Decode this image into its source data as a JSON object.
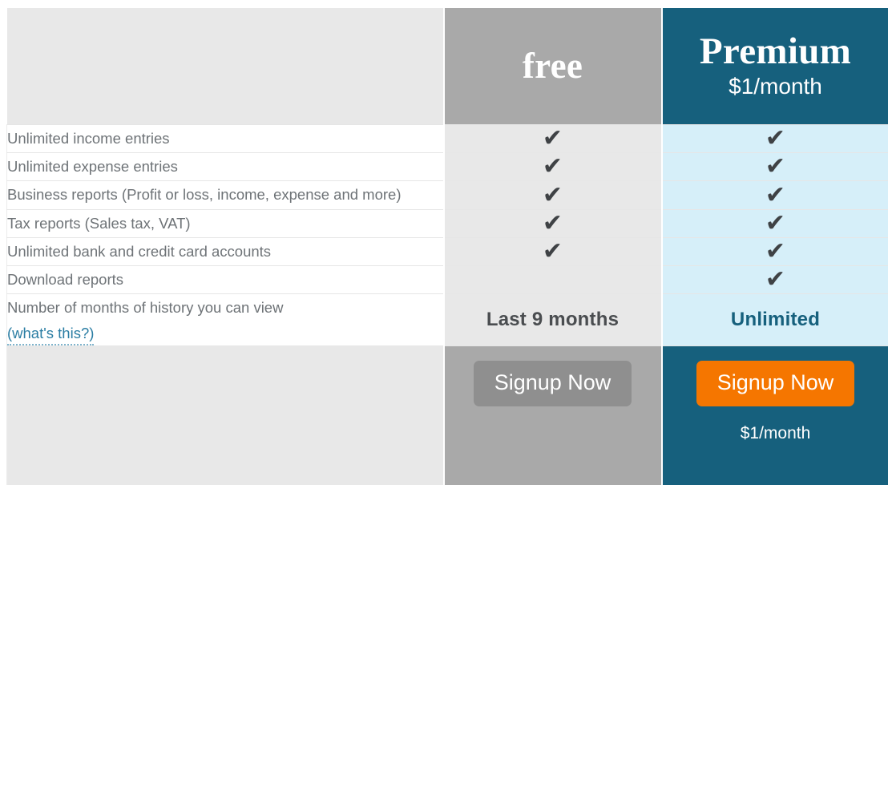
{
  "table": {
    "columns": [
      {
        "key": "feature",
        "label": ""
      },
      {
        "key": "free",
        "label": "free"
      },
      {
        "key": "premium",
        "label": "Premium"
      }
    ],
    "header": {
      "blank_label": "",
      "free": {
        "plan_name": "free",
        "price": ""
      },
      "premium": {
        "plan_name": "Premium",
        "price": "$1/month"
      }
    },
    "rows": [
      {
        "feature": "Unlimited income entries",
        "free": {
          "type": "check",
          "text": "✔"
        },
        "premium": {
          "type": "check",
          "text": "✔"
        }
      },
      {
        "feature": "Unlimited expense entries",
        "free": {
          "type": "check",
          "text": "✔"
        },
        "premium": {
          "type": "check",
          "text": "✔"
        }
      },
      {
        "feature": "Business reports (Profit or loss, income, expense and more)",
        "free": {
          "type": "check",
          "text": "✔"
        },
        "premium": {
          "type": "check",
          "text": "✔"
        }
      },
      {
        "feature": "Tax reports (Sales tax, VAT)",
        "free": {
          "type": "check",
          "text": "✔"
        },
        "premium": {
          "type": "check",
          "text": "✔"
        }
      },
      {
        "feature": "Unlimited bank and credit card accounts",
        "free": {
          "type": "check",
          "text": "✔"
        },
        "premium": {
          "type": "check",
          "text": "✔"
        }
      },
      {
        "feature": "Download reports",
        "free": {
          "type": "empty",
          "text": ""
        },
        "premium": {
          "type": "check",
          "text": "✔"
        }
      },
      {
        "feature": "Number of months of history you can view",
        "feature_link": "(what's this?)",
        "free": {
          "type": "text",
          "text": "Last 9 months"
        },
        "premium": {
          "type": "text",
          "text": "Unlimited"
        }
      }
    ],
    "footer": {
      "free": {
        "button_label": "Signup Now",
        "subnote": ""
      },
      "premium": {
        "button_label": "Signup Now",
        "subnote": "$1/month"
      }
    }
  },
  "colors": {
    "premium_teal": "#16607d",
    "free_gray": "#a9a9a9",
    "free_body_gray": "#e8e8e8",
    "premium_body_blue": "#d6eff9",
    "cta_orange": "#f57600",
    "cta_gray": "#8f8f8f",
    "feature_text": "#6e7377",
    "check_color": "#3f4245",
    "link_color": "#2a7da3"
  }
}
